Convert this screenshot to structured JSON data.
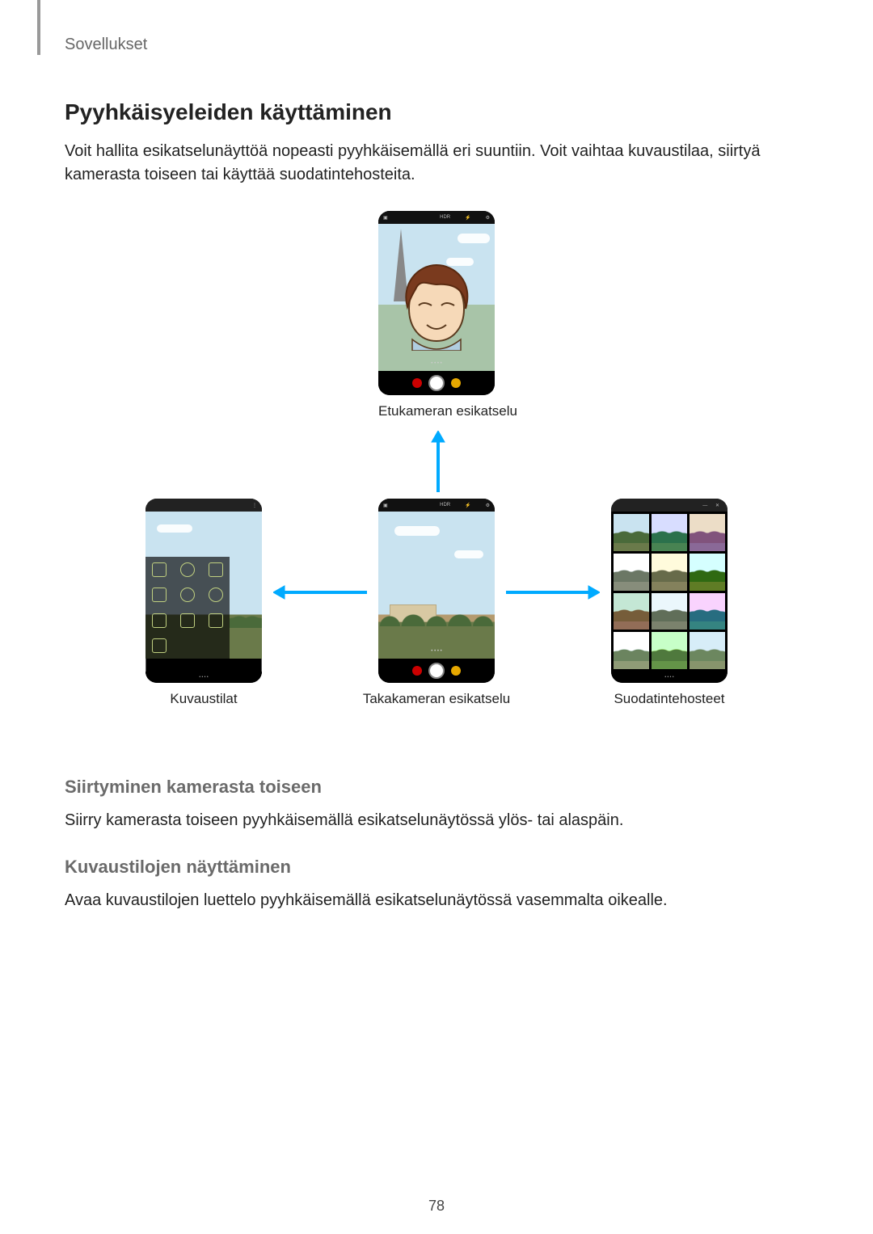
{
  "breadcrumb": "Sovellukset",
  "title": "Pyyhkäisyeleiden käyttäminen",
  "intro": "Voit hallita esikatselunäyttöä nopeasti pyyhkäisemällä eri suuntiin. Voit vaihtaa kuvaustilaa, siirtyä kamerasta toiseen tai käyttää suodatintehosteita.",
  "captions": {
    "front": "Etukameran esikatselu",
    "modes": "Kuvaustilat",
    "rear": "Takakameran esikatselu",
    "filters": "Suodatintehosteet"
  },
  "phone_hdr": "HDR",
  "sections": {
    "switch": {
      "heading": "Siirtyminen kamerasta toiseen",
      "body": "Siirry kamerasta toiseen pyyhkäisemällä esikatselunäytössä ylös- tai alaspäin."
    },
    "modes": {
      "heading": "Kuvaustilojen näyttäminen",
      "body": "Avaa kuvaustilojen luettelo pyyhkäisemällä esikatselunäytössä vasemmalta oikealle."
    }
  },
  "page_number": "78",
  "filter_tints": [
    "none",
    "hue-rotate(40deg) saturate(1.3)",
    "hue-rotate(200deg)",
    "saturate(.3) brightness(1.2)",
    "sepia(.6)",
    "contrast(1.3) saturate(1.4)",
    "hue-rotate(300deg)",
    "grayscale(.6) brightness(1.1)",
    "hue-rotate(90deg) saturate(1.5)",
    "brightness(1.3) saturate(.6)",
    "sepia(.9) hue-rotate(50deg) saturate(2)",
    "contrast(.7) brightness(1.2)"
  ]
}
